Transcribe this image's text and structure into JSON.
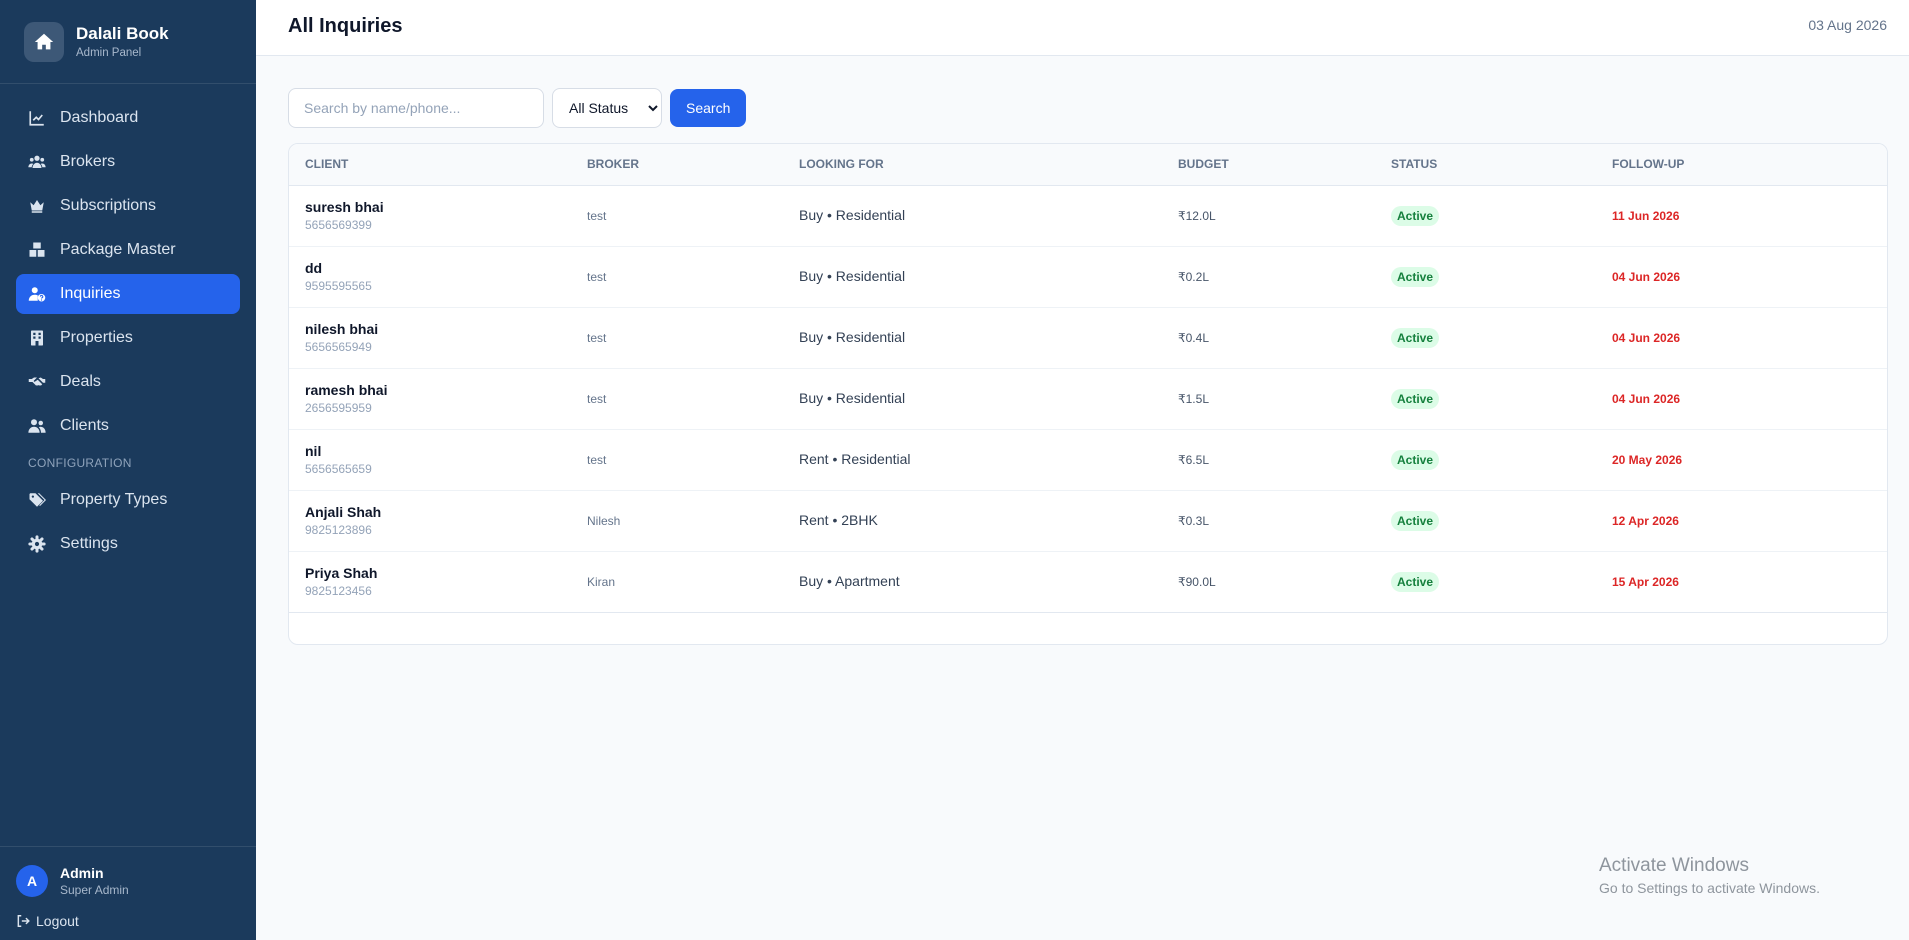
{
  "brand": {
    "title": "Dalali Book",
    "subtitle": "Admin Panel",
    "icon": "home-icon"
  },
  "nav": {
    "items": [
      {
        "label": "Dashboard",
        "icon": "chart-line-icon"
      },
      {
        "label": "Brokers",
        "icon": "users-icon"
      },
      {
        "label": "Subscriptions",
        "icon": "crown-icon"
      },
      {
        "label": "Package Master",
        "icon": "boxes-icon"
      },
      {
        "label": "Inquiries",
        "icon": "user-question-icon",
        "active": true
      },
      {
        "label": "Properties",
        "icon": "building-icon"
      },
      {
        "label": "Deals",
        "icon": "handshake-icon"
      },
      {
        "label": "Clients",
        "icon": "user-group-icon"
      }
    ],
    "section_label": "CONFIGURATION",
    "config_items": [
      {
        "label": "Property Types",
        "icon": "tags-icon"
      },
      {
        "label": "Settings",
        "icon": "gear-icon"
      }
    ]
  },
  "user": {
    "initial": "A",
    "name": "Admin",
    "role": "Super Admin",
    "logout_label": "Logout"
  },
  "header": {
    "title": "All Inquiries",
    "date": "03 Aug 2026"
  },
  "filters": {
    "search_placeholder": "Search by name/phone...",
    "status_selected": "All Status",
    "search_button": "Search"
  },
  "table": {
    "columns": [
      "CLIENT",
      "BROKER",
      "LOOKING FOR",
      "BUDGET",
      "STATUS",
      "FOLLOW-UP"
    ],
    "rows": [
      {
        "name": "suresh bhai",
        "phone": "5656569399",
        "broker": "test",
        "looking": "Buy • Residential",
        "budget": "₹12.0L",
        "status": "Active",
        "followup": "11 Jun 2026"
      },
      {
        "name": "dd",
        "phone": "9595595565",
        "broker": "test",
        "looking": "Buy • Residential",
        "budget": "₹0.2L",
        "status": "Active",
        "followup": "04 Jun 2026"
      },
      {
        "name": "nilesh bhai",
        "phone": "5656565949",
        "broker": "test",
        "looking": "Buy • Residential",
        "budget": "₹0.4L",
        "status": "Active",
        "followup": "04 Jun 2026"
      },
      {
        "name": "ramesh bhai",
        "phone": "2656595959",
        "broker": "test",
        "looking": "Buy • Residential",
        "budget": "₹1.5L",
        "status": "Active",
        "followup": "04 Jun 2026"
      },
      {
        "name": "nil",
        "phone": "5656565659",
        "broker": "test",
        "looking": "Rent • Residential",
        "budget": "₹6.5L",
        "status": "Active",
        "followup": "20 May 2026"
      },
      {
        "name": "Anjali Shah",
        "phone": "9825123896",
        "broker": "Nilesh",
        "looking": "Rent • 2BHK",
        "budget": "₹0.3L",
        "status": "Active",
        "followup": "12 Apr 2026"
      },
      {
        "name": "Priya Shah",
        "phone": "9825123456",
        "broker": "Kiran",
        "looking": "Buy • Apartment",
        "budget": "₹90.0L",
        "status": "Active",
        "followup": "15 Apr 2026"
      }
    ]
  },
  "watermark": {
    "title": "Activate Windows",
    "subtitle": "Go to Settings to activate Windows."
  },
  "colors": {
    "sidebar": "#1b3a5c",
    "accent": "#2563eb",
    "success_text": "#15803d",
    "success_bg": "#dcfce7",
    "danger": "#dc2626"
  }
}
